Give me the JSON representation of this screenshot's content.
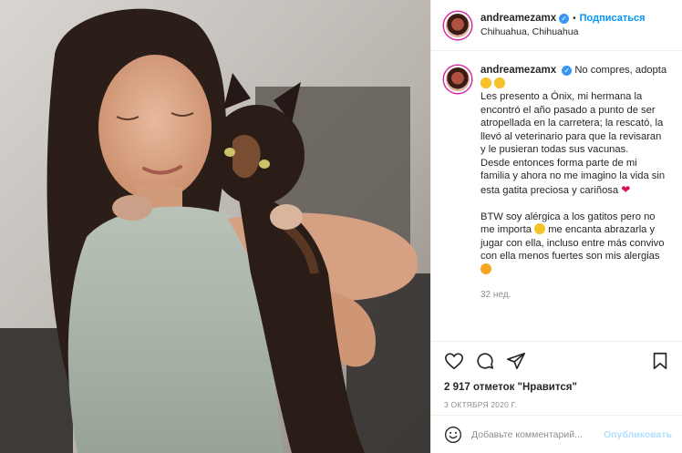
{
  "post": {
    "username": "andreamezamx",
    "follow_label": "Подписаться",
    "separator": "•",
    "location": "Chihuahua, Chihuahua",
    "verified_icon": "verified-badge-icon"
  },
  "caption": {
    "username": "andreamezamx",
    "line1": "No compres, adopta",
    "paragraph1": "Les presento a Ónix, mi hermana la encontró el año pasado a punto de ser atropellada en la carretera; la rescató, la llevó al veterinario para que la revisaran y le pusieran todas sus vacunas.",
    "paragraph2": "Desde entonces forma parte de mi familia y ahora no me imagino la vida sin esta gatita preciosa y cariñosa",
    "paragraph3a": "BTW soy alérgica a los gatitos pero no me importa",
    "paragraph3b": "me encanta abrazarla y jugar con ella, incluso entre más convivo con ella menos fuertes son mis alergias",
    "time_ago": "32 нед."
  },
  "actions": {
    "icons": [
      "heart-icon",
      "comment-icon",
      "share-icon",
      "bookmark-icon"
    ],
    "likes": "2 917 отметок \"Нравится\"",
    "date": "3 ОКТЯБРЯ 2020 Г."
  },
  "comment": {
    "placeholder": "Добавьте комментарий...",
    "publish_label": "Опубликовать",
    "emoji_icon": "emoji-icon"
  },
  "colors": {
    "accent": "#0095f6",
    "publish_disabled": "#b2dffc",
    "verified": "#3897f0",
    "muted": "#8e8e8e",
    "text": "#262626",
    "heart_emoji": "#d9134d"
  }
}
